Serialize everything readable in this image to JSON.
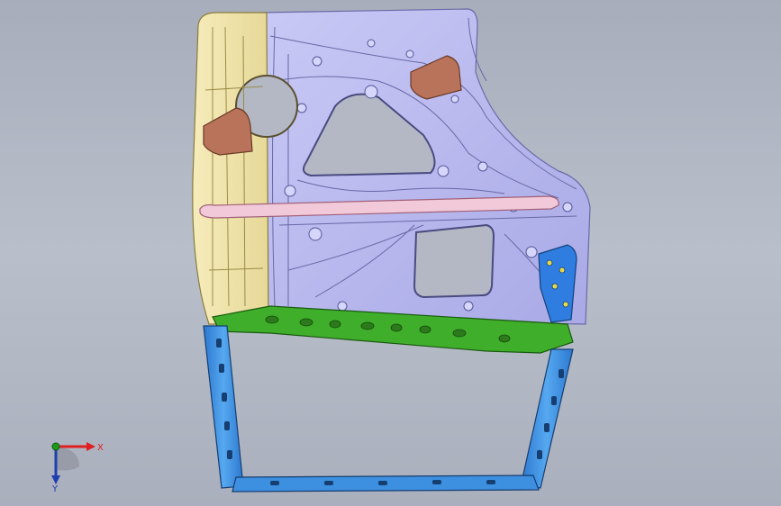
{
  "triad": {
    "x_label": "X",
    "y_label": "Y",
    "colors": {
      "x": "#e02020",
      "y": "#1a7a1a",
      "z": "#1e3fb0"
    }
  },
  "parts": [
    {
      "name": "inner-panel",
      "color": "#b8b8f0"
    },
    {
      "name": "hinge-reinforcement",
      "color": "#efe3a6"
    },
    {
      "name": "beltline-beam",
      "color": "#3fae2a"
    },
    {
      "name": "frame",
      "color": "#3d8fe0"
    },
    {
      "name": "bracket",
      "color": "#b8735a"
    },
    {
      "name": "latch-reinforcement",
      "color": "#2f7de0"
    },
    {
      "name": "impact-bar",
      "color": "#f1c9d8"
    }
  ]
}
